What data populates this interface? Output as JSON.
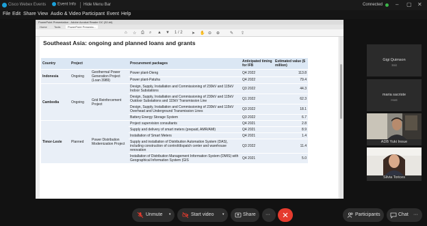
{
  "titlebar": {
    "app_name": "Cisco Webex Events",
    "event_info": "Event Info",
    "hide_menu_bar": "Hide Menu Bar",
    "status": "Connected"
  },
  "menu": [
    "File",
    "Edit",
    "Share",
    "View",
    "Audio & Video",
    "Participant",
    "Event",
    "Help"
  ],
  "viewer": {
    "window_title": "PowerPoint Presentation - Adobe Acrobat Reader DC (32-bit)",
    "tabs": [
      "Home",
      "Tools",
      "PowerPoint Presenta..."
    ],
    "page_indicator": "1 / 2"
  },
  "document": {
    "title": "Southeast Asia: ongoing and planned loans and grants",
    "headers": [
      "Country",
      "Project",
      "",
      "Procurement packages",
      "Anticipated timing for IFB",
      "Estimated value ($ million)"
    ],
    "rows": [
      {
        "country": "Indonesia",
        "status": "Ongoing",
        "project": "Geothermal Power Generation Project (Loan 3989)",
        "package": "Power plant-Dieng",
        "timing": "Q4 2022",
        "value": "113.8"
      },
      {
        "package": "Power plant-Patuha",
        "timing": "Q4 2022",
        "value": "79.4"
      },
      {
        "country": "Cambodia",
        "status": "Ongoing",
        "project": "Grid Reinforcement Project",
        "package": "Design, Supply, Installation and Commissioning of 230kV and 115kV Indoor Substations",
        "timing": "Q3 2022",
        "value": "44.3"
      },
      {
        "package": "Design, Supply, Installation and Commissioning of 230kV and 115kV Outdoor Substations and 115kV Transmission Line",
        "timing": "Q1 2022",
        "value": "62.3"
      },
      {
        "package": "Design, Supply, Installation and Commissioning of 230kV and 115kV Overhead and Underground Transmission Lines",
        "timing": "Q3 2022",
        "value": "18.1"
      },
      {
        "package": "Battery Energy Storage System",
        "timing": "Q3 2022",
        "value": "6.7"
      },
      {
        "country": "Timor-Leste",
        "status": "Planned",
        "project": "Power Distribution Modernization Project",
        "package": "Project supervision consultants",
        "timing": "Q4 2021",
        "value": "2.8"
      },
      {
        "package": "Supply and delivery of smart meters (prepaid, AMR/AMI)",
        "timing": "Q4 2021",
        "value": "8.9"
      },
      {
        "package": "Installation of Smart Meters",
        "timing": "Q4 2021",
        "value": "1.4"
      },
      {
        "package": "Supply and installation of Distribution Automation System (DAS), including construction of control/dispatch center and warehouse renovation",
        "timing": "Q3 2022",
        "value": "11.4"
      },
      {
        "package": "Installation of Distribution Management Information System (DMIS) with Geographical Information System (GIS",
        "timing": "Q4 2021",
        "value": "5.0"
      }
    ]
  },
  "participants": [
    {
      "name": "Gigi Quimson",
      "role": "Ssit"
    },
    {
      "name": "maria sacriste",
      "role": "Host"
    },
    {
      "name": "ADB Yuki Inoue",
      "role": ""
    },
    {
      "name": "Silvia Torices",
      "role": ""
    }
  ],
  "controls": {
    "mute": "Unmute",
    "video": "Start video",
    "share": "Share",
    "participants": "Participants",
    "chat": "Chat"
  },
  "colors": {
    "end_button": "#e53b2e",
    "table_header": "#dbe7f4",
    "table_row": "#e9eff7",
    "connected_dot": "#3bb54a"
  }
}
